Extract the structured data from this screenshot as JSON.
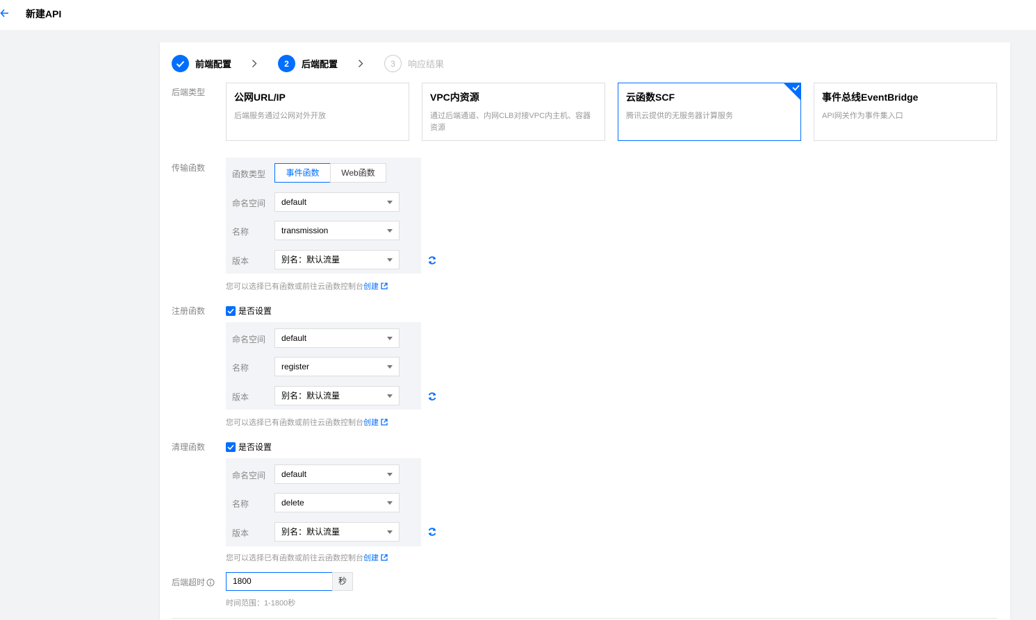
{
  "header": {
    "title": "新建API",
    "back_icon": "arrow-left-icon"
  },
  "steps": [
    {
      "number": "1",
      "label": "前端配置",
      "state": "done"
    },
    {
      "number": "2",
      "label": "后端配置",
      "state": "active"
    },
    {
      "number": "3",
      "label": "响应结果",
      "state": "todo"
    }
  ],
  "backend_type": {
    "label": "后端类型",
    "options": [
      {
        "title": "公网URL/IP",
        "desc": "后端服务通过公网对外开放"
      },
      {
        "title": "VPC内资源",
        "desc": "通过后端通道、内网CLB对接VPC内主机、容器资源"
      },
      {
        "title": "云函数SCF",
        "desc": "腾讯云提供的无服务器计算服务",
        "selected": true
      },
      {
        "title": "事件总线EventBridge",
        "desc": "API网关作为事件集入口"
      }
    ]
  },
  "transmission": {
    "label": "传输函数",
    "func_type_label": "函数类型",
    "func_types": [
      "事件函数",
      "Web函数"
    ],
    "namespace_label": "命名空间",
    "namespace": "default",
    "name_label": "名称",
    "name": "transmission",
    "version_label": "版本",
    "version": "别名：默认流量"
  },
  "register": {
    "label": "注册函数",
    "checkbox_label": "是否设置",
    "namespace_label": "命名空间",
    "namespace": "default",
    "name_label": "名称",
    "name": "register",
    "version_label": "版本",
    "version": "别名：默认流量"
  },
  "cleanup": {
    "label": "清理函数",
    "checkbox_label": "是否设置",
    "namespace_label": "命名空间",
    "namespace": "default",
    "name_label": "名称",
    "name": "delete",
    "version_label": "版本",
    "version": "别名：默认流量"
  },
  "hint": {
    "text": "您可以选择已有函数或前往云函数控制台",
    "link": "创建"
  },
  "timeout": {
    "label": "后端超时",
    "value": "1800",
    "unit": "秒",
    "range_hint": "时间范围：1-1800秒"
  },
  "colors": {
    "accent": "#006eff",
    "panel_bg": "#f3f4f7",
    "page_bg": "#f2f3f5"
  }
}
